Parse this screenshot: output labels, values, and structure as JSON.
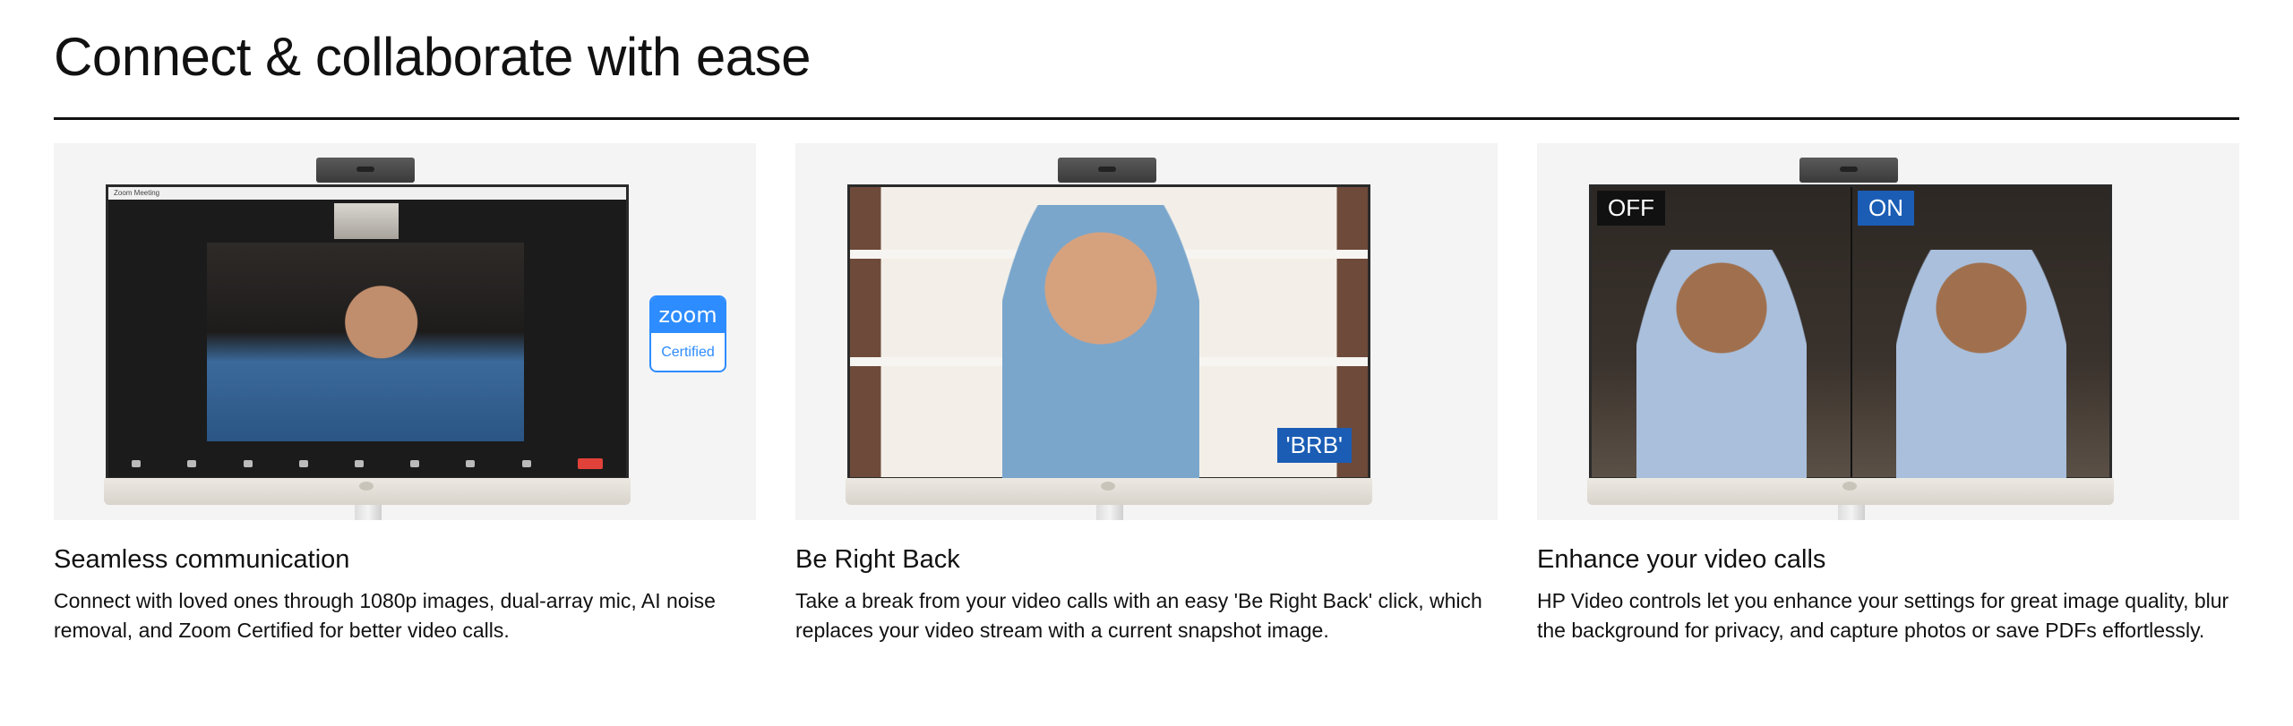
{
  "section": {
    "title": "Connect & collaborate with ease"
  },
  "cards": [
    {
      "title": "Seamless communication",
      "description": "Connect with loved ones through 1080p images, dual-array mic, AI noise removal, and Zoom Certified for better video calls.",
      "zoom_app_title": "Zoom Meeting",
      "badge": {
        "brand": "zoom",
        "label": "Certified"
      }
    },
    {
      "title": "Be Right Back",
      "description": "Take a break from your video calls with an easy 'Be Right Back' click, which replaces your video stream with a current snapshot image.",
      "badge_label": "'BRB'"
    },
    {
      "title": "Enhance your video calls",
      "description": "HP Video controls let you enhance your settings for great image quality, blur the background for privacy, and capture photos or save PDFs effortlessly.",
      "off_label": "OFF",
      "on_label": "ON"
    }
  ],
  "colors": {
    "zoom_blue": "#2d8cff",
    "hp_blue": "#1b5db5",
    "media_bg": "#f4f4f4"
  }
}
